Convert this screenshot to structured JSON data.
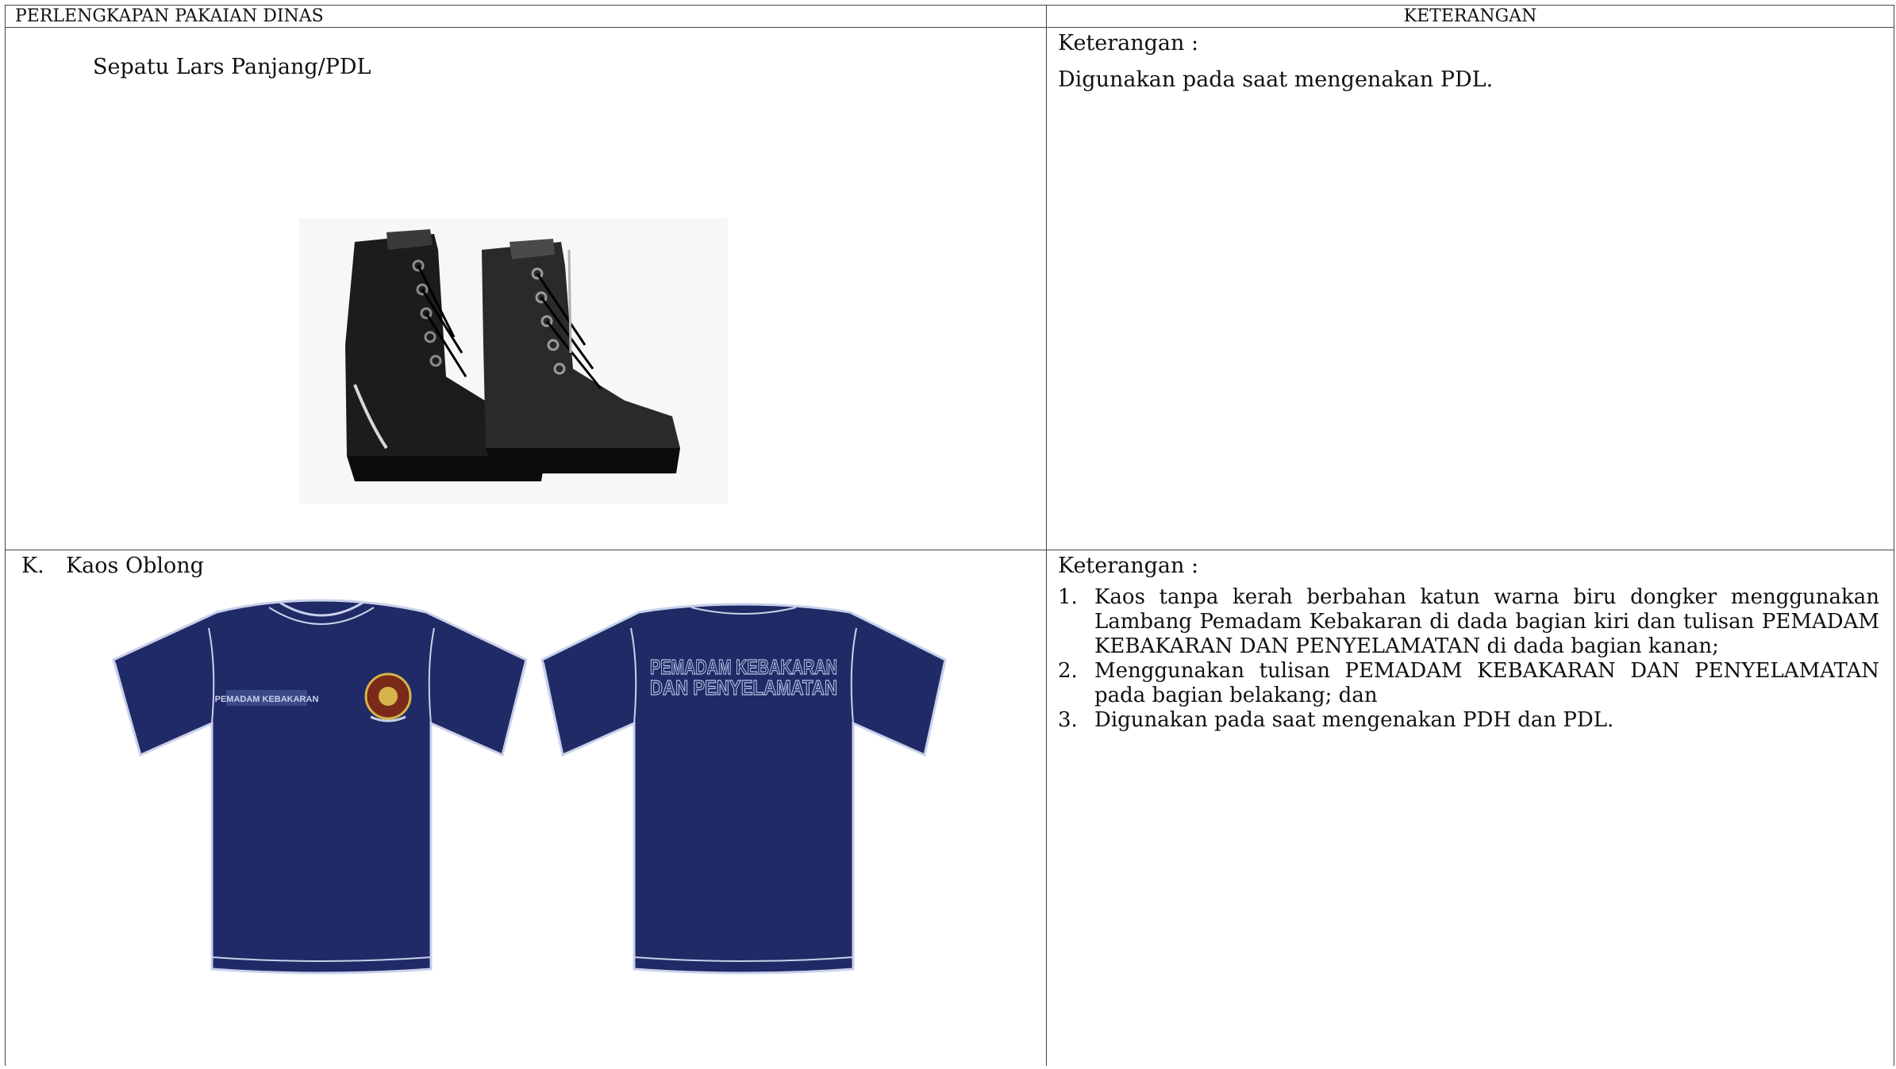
{
  "header": {
    "left": "PERLENGKAPAN PAKAIAN DINAS",
    "right": "KETERANGAN"
  },
  "rows": [
    {
      "title": "Sepatu Lars Panjang/PDL",
      "image": "boots-photo",
      "ket_label": "Keterangan :",
      "ket_text": "Digunakan pada saat mengenakan PDL."
    },
    {
      "marker": "K.",
      "title": "Kaos Oblong",
      "image": "tshirt-illustration",
      "shirt_front_label": "PEMADAM KEBAKARAN",
      "shirt_back_text": [
        "PEMADAM KEBAKARAN",
        "DAN PENYELAMATAN"
      ],
      "shirt_color": "#1f2a66",
      "ket_label": "Keterangan :",
      "items": [
        {
          "num": "1.",
          "text": "Kaos tanpa kerah berbahan katun warna biru dongker menggunakan Lambang  Pemadam Kebakaran  di dada bagian kiri dan tulisan PEMADAM KEBAKARAN DAN PENYELAMATAN di dada bagian kanan;"
        },
        {
          "num": "2.",
          "text": "Menggunakan tulisan PEMADAM KEBAKARAN DAN PENYELAMATAN pada bagian belakang; dan"
        },
        {
          "num": "3.",
          "text": "Digunakan pada saat mengenakan PDH dan PDL."
        }
      ]
    }
  ]
}
